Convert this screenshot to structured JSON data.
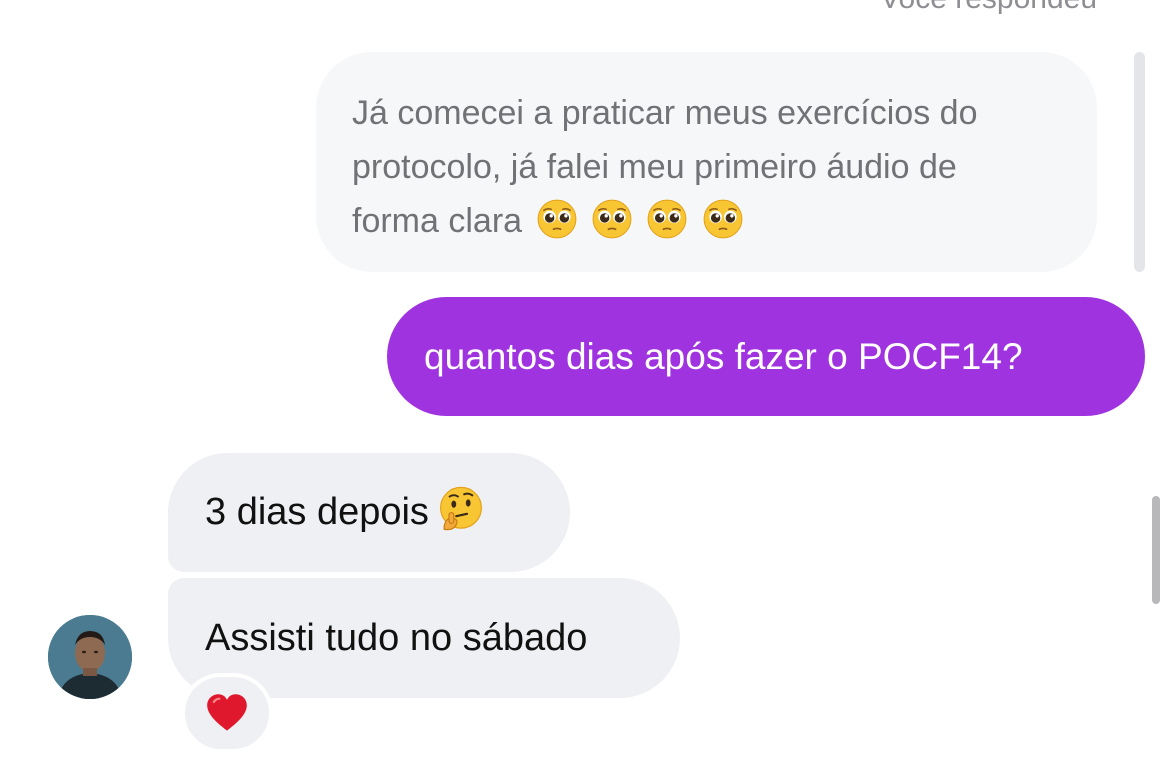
{
  "reply": {
    "caption": "Você respondeu",
    "quoted_line1": "Já comecei a praticar meus exercícios do",
    "quoted_line2": "protocolo, já falei meu primeiro áudio de",
    "quoted_line3": "forma clara",
    "quoted_emojis": [
      "pleading-face-icon",
      "pleading-face-icon",
      "pleading-face-icon",
      "pleading-face-icon"
    ]
  },
  "sent_message": {
    "text": "quantos dias após fazer o POCF14?",
    "color": "#a033e0"
  },
  "received_messages": [
    {
      "text": "3 dias depois",
      "emoji": "thinking-face-icon"
    },
    {
      "text": "Assisti tudo no sábado",
      "reaction": "red-heart-icon"
    }
  ],
  "sender": {
    "avatar": "profile-photo"
  },
  "colors": {
    "sent_bubble": "#a033e0",
    "received_bubble": "#eff0f3",
    "quoted_bubble": "#f6f7f9",
    "heart": "#e0182d"
  }
}
